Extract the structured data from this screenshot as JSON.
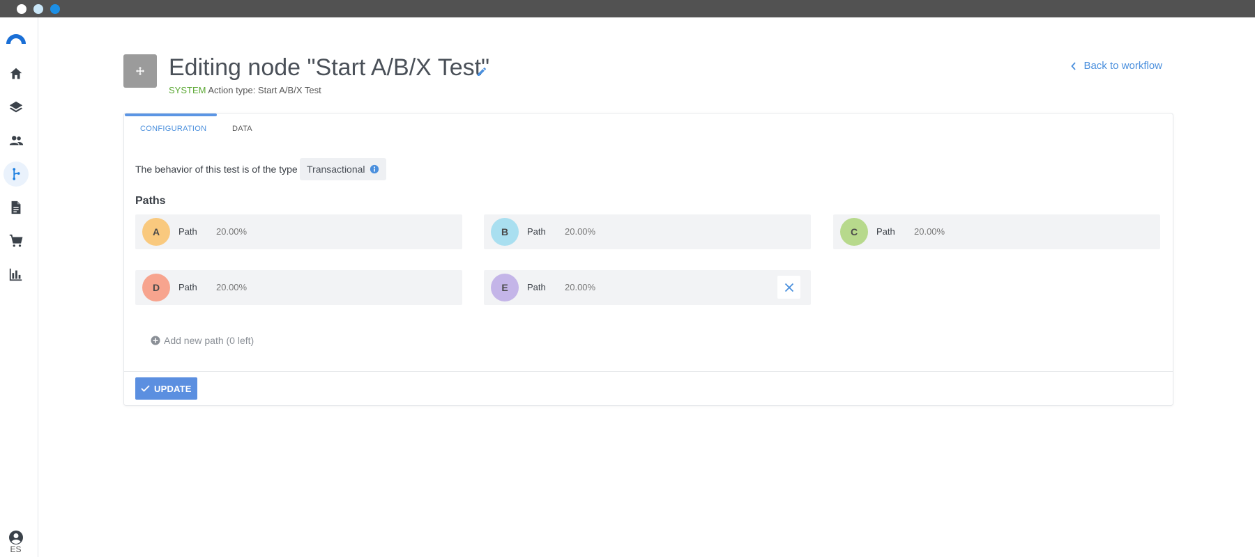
{
  "window": {
    "dots": [
      {
        "name": "window-close-dot",
        "color": "#ffffff"
      },
      {
        "name": "window-minimize-dot",
        "color": "#c9e6f7"
      },
      {
        "name": "window-zoom-dot",
        "color": "#1c8fe5"
      }
    ]
  },
  "sidebar": {
    "items": [
      {
        "icon": "home-icon",
        "label": "Home"
      },
      {
        "icon": "layers-icon",
        "label": "Layers"
      },
      {
        "icon": "people-icon",
        "label": "Contacts"
      },
      {
        "icon": "workflow-icon",
        "label": "Workflows",
        "active": true
      },
      {
        "icon": "document-icon",
        "label": "Documents"
      },
      {
        "icon": "cart-icon",
        "label": "Commerce"
      },
      {
        "icon": "chart-icon",
        "label": "Reports"
      }
    ],
    "language": "ES"
  },
  "header": {
    "title": "Editing node \"Start A/B/X Test\"",
    "system_label": "SYSTEM",
    "action_type": "Action type: Start A/B/X Test",
    "back_link": "Back to workflow"
  },
  "tabs": [
    {
      "label": "CONFIGURATION",
      "active": true
    },
    {
      "label": "DATA",
      "active": false
    }
  ],
  "behavior": {
    "text": "The behavior of this test is of the type",
    "type": "Transactional"
  },
  "paths_title": "Paths",
  "paths": [
    {
      "letter": "A",
      "label": "Path",
      "percent": "20.00%",
      "color": "#f9c97e"
    },
    {
      "letter": "B",
      "label": "Path",
      "percent": "20.00%",
      "color": "#a9dff0"
    },
    {
      "letter": "C",
      "label": "Path",
      "percent": "20.00%",
      "color": "#b7d98c"
    },
    {
      "letter": "D",
      "label": "Path",
      "percent": "20.00%",
      "color": "#f7a48e"
    },
    {
      "letter": "E",
      "label": "Path",
      "percent": "20.00%",
      "color": "#c4b5e8",
      "removable": true
    }
  ],
  "add_path": "Add new path (0 left)",
  "update_button": "UPDATE",
  "colors": {
    "accent": "#4a8fdd",
    "primary_button": "#5b8fe0",
    "system": "#5aa732"
  }
}
